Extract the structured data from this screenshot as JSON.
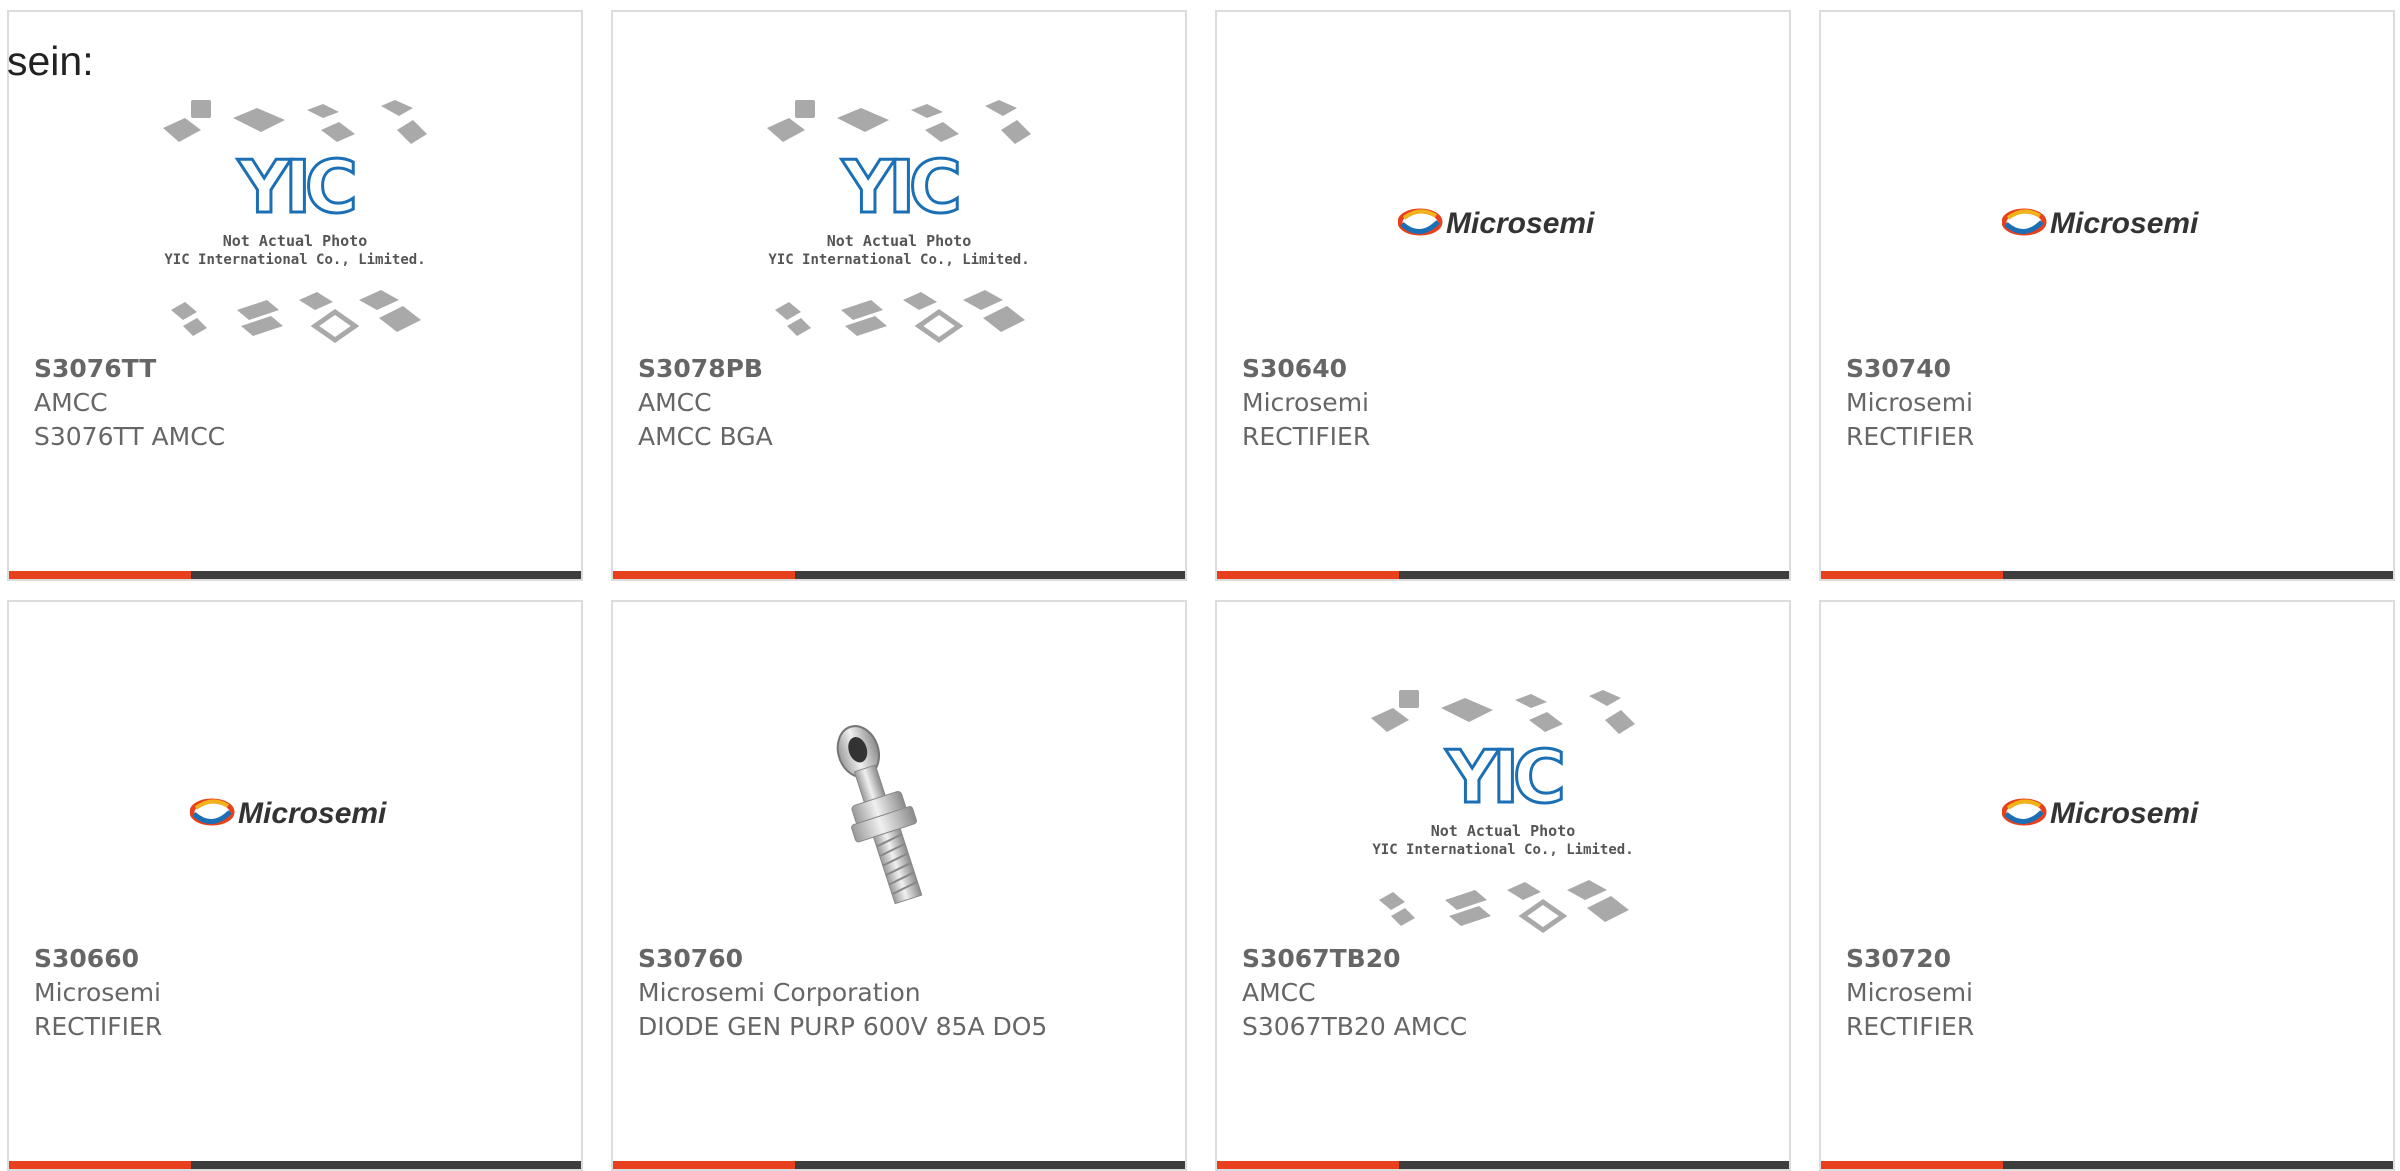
{
  "intro_text": "sein:",
  "products": [
    {
      "part": "S3076TT",
      "manufacturer": "AMCC",
      "description": "S3076TT AMCC",
      "image": "yic-placeholder"
    },
    {
      "part": "S3078PB",
      "manufacturer": "AMCC",
      "description": "AMCC BGA",
      "image": "yic-placeholder"
    },
    {
      "part": "S30640",
      "manufacturer": "Microsemi",
      "description": "RECTIFIER",
      "image": "microsemi-logo"
    },
    {
      "part": "S30740",
      "manufacturer": "Microsemi",
      "description": "RECTIFIER",
      "image": "microsemi-logo"
    },
    {
      "part": "S30660",
      "manufacturer": "Microsemi",
      "description": "RECTIFIER",
      "image": "microsemi-logo"
    },
    {
      "part": "S30760",
      "manufacturer": "Microsemi Corporation",
      "description": "DIODE GEN PURP 600V 85A DO5",
      "image": "stud-diode-photo"
    },
    {
      "part": "S3067TB20",
      "manufacturer": "AMCC",
      "description": "S3067TB20 AMCC",
      "image": "yic-placeholder"
    },
    {
      "part": "S30720",
      "manufacturer": "Microsemi",
      "description": "RECTIFIER",
      "image": "microsemi-logo"
    }
  ],
  "placeholder": {
    "logo_text": "YIC",
    "line1": "Not Actual Photo",
    "line2": "YIC International Co., Limited."
  },
  "microsemi_logo_text": "Microsemi",
  "colors": {
    "accent": "#e8401c",
    "bar": "#3d3d3d",
    "text": "#666666",
    "border": "#dcdcdc",
    "yic_blue": "#1b6fb4"
  }
}
